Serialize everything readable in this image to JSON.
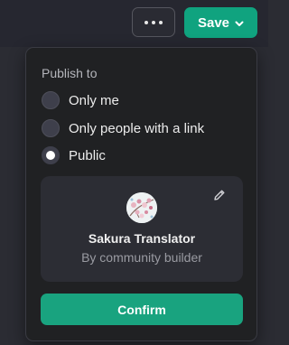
{
  "header": {
    "more_icon": "ellipsis-icon",
    "save_label": "Save",
    "save_icon": "chevron-down-icon",
    "accent": "#10a37f"
  },
  "publish": {
    "title": "Publish to",
    "options": [
      {
        "label": "Only me",
        "checked": false
      },
      {
        "label": "Only people with a link",
        "checked": false
      },
      {
        "label": "Public",
        "checked": true
      }
    ]
  },
  "gizmo": {
    "name": "Sakura Translator",
    "author": "By community builder",
    "edit_icon": "pencil-icon",
    "avatar_icon": "sakura-blossom-avatar"
  },
  "confirm_label": "Confirm"
}
